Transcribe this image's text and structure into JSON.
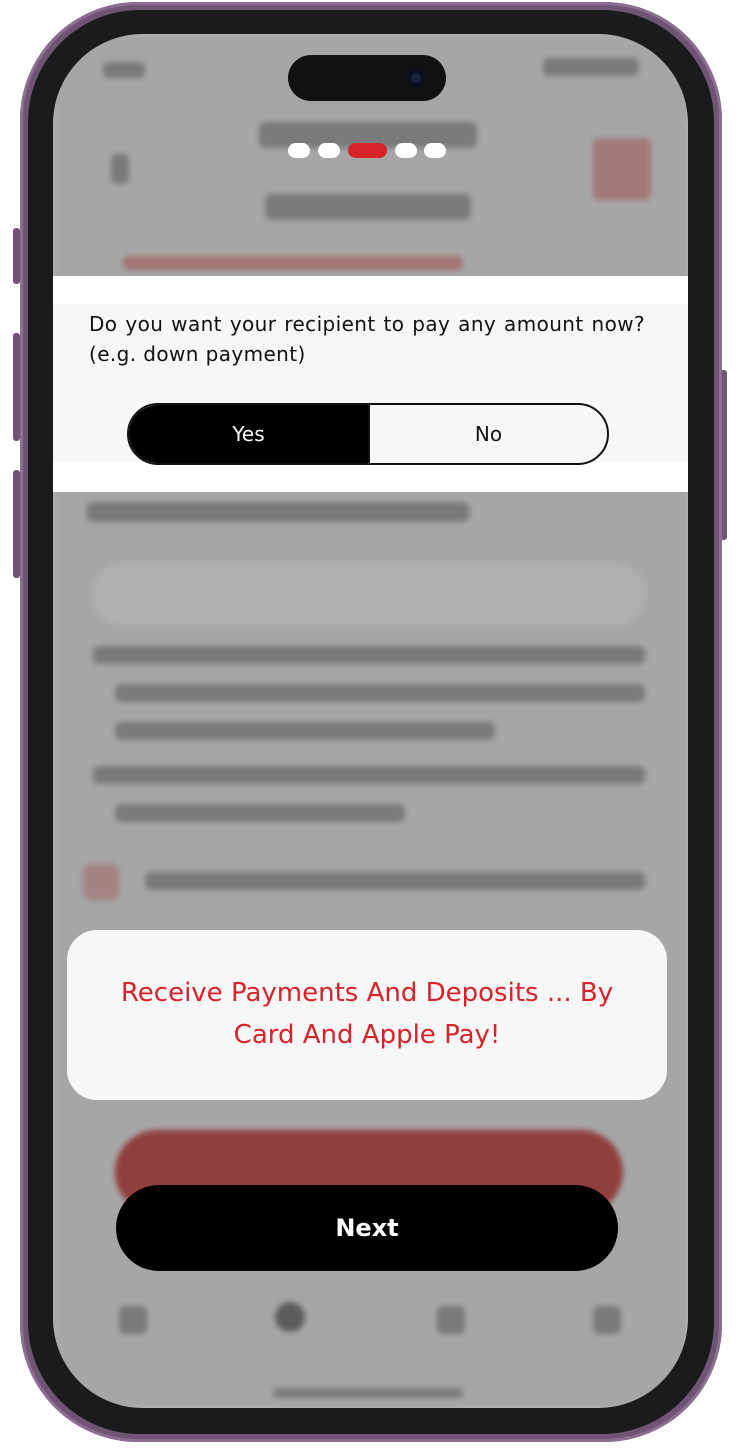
{
  "onboarding": {
    "total_steps": 5,
    "current_step": 3,
    "accent_color": "#d6232a"
  },
  "question": {
    "text": "Do you want your recipient to pay any amount now? (e.g. down payment)",
    "options": [
      "Yes",
      "No"
    ],
    "selected": "Yes"
  },
  "promo": {
    "text": "Receive Payments And Deposits ... By Card And Apple Pay!"
  },
  "next_button": {
    "label": "Next"
  }
}
